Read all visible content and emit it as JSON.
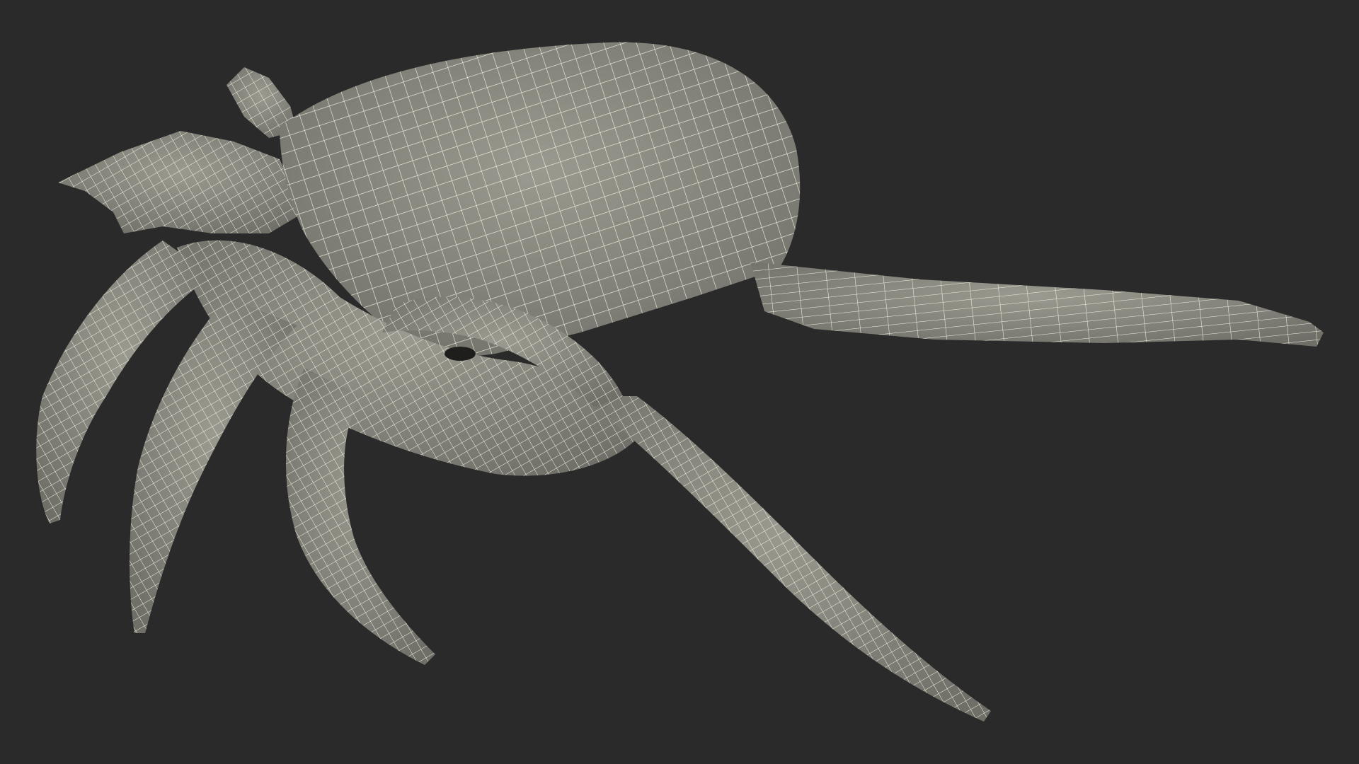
{
  "scene": {
    "background_color": "#2a2a2a",
    "mesh_fill_color": "#8d8d84",
    "mesh_shade_color": "#6f6f68",
    "wire_color": "#f2f2e4",
    "render_style": "wireframe-over-shaded",
    "subject_icon": "spider-conch-shell-icon"
  }
}
